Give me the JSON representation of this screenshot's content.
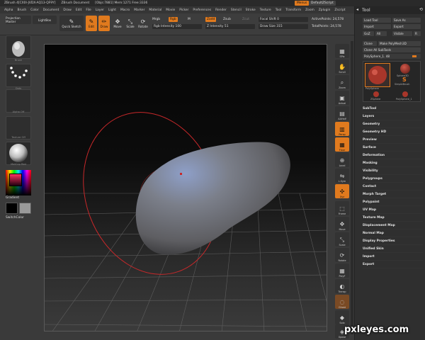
{
  "titlebar": {
    "items": [
      "ZBrush 4[CX0I-JVDX-AQ13-QF9Y]",
      "ZBrush Document",
      "[Objs:7881] Mem:1271 Free:3336"
    ],
    "menu_button": "Menus",
    "script_button": "DefaultZScript"
  },
  "menubar": {
    "items": [
      "Alpha",
      "Brush",
      "Color",
      "Document",
      "Draw",
      "Edit",
      "File",
      "Layer",
      "Light",
      "Macro",
      "Marker",
      "Material",
      "Movie",
      "Picker",
      "Preferences",
      "Render",
      "Stencil",
      "Stroke",
      "Texture",
      "Tool",
      "Transform",
      "Zoom",
      "Zplugin",
      "Zscript"
    ]
  },
  "toolbar": {
    "projection_master": "Projection Master",
    "lightbox": "LightBox",
    "quick_sketch": "Quick Sketch",
    "edit": "Edit",
    "draw": "Draw",
    "move": "Move",
    "scale": "Scale",
    "rotate": "Rotate",
    "mrgb": "Mrgb",
    "rgb": "Rgb",
    "m": "M",
    "rgb_intensity": "Rgb Intensity 100",
    "zadd": "Zadd",
    "zsub": "Zsub",
    "z_intensity": "Z Intensity 51",
    "zcut": "Zcut",
    "focal_shift": "Focal Shift 0",
    "draw_size": "Draw Size 315",
    "active_points": "ActivePoints: 24,578",
    "total_points": "TotalPoints: 24,578"
  },
  "left_panel": {
    "tiles": [
      "Brush",
      "Dots",
      "Alpha Off",
      "Texture Off",
      "MatCap Red"
    ],
    "gradient_label": "Gradient",
    "switch_color_label": "SwitchColor"
  },
  "right_strip": {
    "buttons": [
      "SPix",
      "Scroll",
      "Zoom",
      "Actual",
      "AAHalf",
      "Persp",
      "Floor",
      "Local",
      "L.Sym",
      "Xyz",
      "Frame",
      "Move",
      "Scale",
      "Rotate",
      "PolyF",
      "Transp",
      "Ghost",
      "Solo",
      "Xpose"
    ]
  },
  "tool_panel": {
    "title": "Tool",
    "load_tool": "Load Tool",
    "save_as": "Save As",
    "import": "Import",
    "export": "Export",
    "goz": "GoZ",
    "all": "All",
    "visible": "Visible",
    "r": "R",
    "clone": "Clone",
    "make_polymesh": "Make PolyMesh3D",
    "clone_all_subtools": "Clone All SubTools",
    "current_tool": "PolySphere_1. 48",
    "tools": [
      "PolySphere",
      "Sphere3D",
      "SimpleBrush",
      "ZSphere",
      "PolySphere_1"
    ],
    "sections": [
      "SubTool",
      "Layers",
      "Geometry",
      "Geometry HD",
      "Preview",
      "Surface",
      "Deformation",
      "Masking",
      "Visibility",
      "Polygroups",
      "Contact",
      "Morph Target",
      "Polypaint",
      "UV Map",
      "Texture Map",
      "Displacement Map",
      "Normal Map",
      "Display Properties",
      "Unified Skin",
      "Import",
      "Export"
    ]
  },
  "watermark": "pxleyes.com",
  "colors": {
    "accent": "#e07a1e",
    "panel": "#3c3c3c",
    "brush_ring": "#c8282a"
  }
}
